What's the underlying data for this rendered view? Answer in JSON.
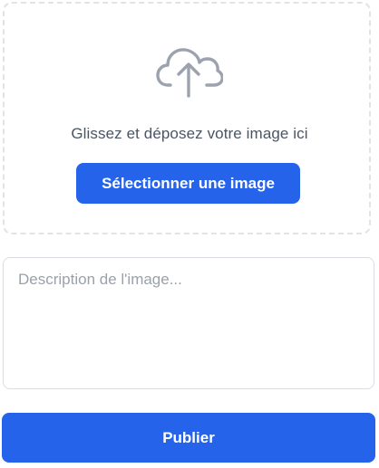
{
  "upload": {
    "icon": "cloud-upload-icon",
    "drop_text": "Glissez et déposez votre image ici",
    "select_label": "Sélectionner une image"
  },
  "description": {
    "value": "",
    "placeholder": "Description de l'image..."
  },
  "publish": {
    "label": "Publier"
  },
  "colors": {
    "accent": "#2563eb",
    "icon": "#9ca3af",
    "dropzone_border": "#e0e3e8",
    "text": "#4b5563",
    "placeholder": "#9aa1ab"
  }
}
